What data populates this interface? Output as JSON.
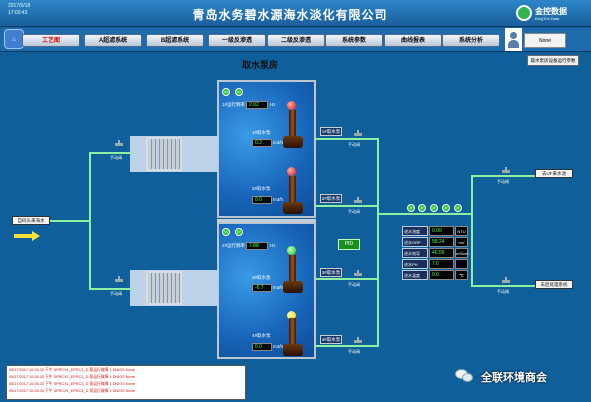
{
  "header": {
    "date": "2017/5/18",
    "time": "17:00:43",
    "title": "青岛水务碧水源海水淡化有限公司",
    "logo_main": "金控数据",
    "logo_sub": "KingTrol Data"
  },
  "nav": {
    "home_icon": "home-icon",
    "tabs": [
      "工艺图",
      "A超滤系统",
      "B超滤系统",
      "一级反渗透",
      "二级反渗透",
      "系统参数",
      "曲线报表",
      "系统分析"
    ],
    "active_tab": "工艺图",
    "user_icon": "user-icon",
    "username": "None"
  },
  "page": {
    "title": "取水泵房",
    "right_button": "取水泵房设备运行参数"
  },
  "pipes": {
    "seawater_in": "自码头来海水",
    "manual_valve": "手动阀",
    "outlets": [
      "去UF来水池",
      "去后处理系统"
    ]
  },
  "pumps": [
    {
      "status": "1#运行频率",
      "freq": "2.02",
      "freq_unit": "Hz",
      "name": "1#取水泵",
      "value": "0.2",
      "unit": "m3/h",
      "tag": "1#取水泵",
      "lamp": "red"
    },
    {
      "status": "",
      "freq": "",
      "freq_unit": "",
      "name": "2#取水泵",
      "value": "0.0",
      "unit": "m3/h",
      "tag": "2#取水泵",
      "lamp": "red"
    },
    {
      "status": "2#运行频率",
      "freq": "7.88",
      "freq_unit": "Hz",
      "name": "3#取水泵",
      "value": "-6.7",
      "unit": "m3/h",
      "tag": "3#取水泵",
      "lamp": "green"
    },
    {
      "status": "",
      "freq": "",
      "freq_unit": "",
      "name": "4#取水泵",
      "value": "0.0",
      "unit": "m3/h",
      "tag": "4#取水泵",
      "lamp": "yellow"
    }
  ],
  "indicators": {
    "d1": "SS",
    "d2": "DT",
    "d3": "SS",
    "d4": "DT",
    "grid": [
      "AT",
      "AT",
      "AT",
      "AT",
      "AT"
    ]
  },
  "pid_button": "PID",
  "quality": {
    "rows": [
      {
        "name": "进水浊度",
        "value": "0.00",
        "unit": "NTU"
      },
      {
        "name": "进水ORP",
        "value": "58.24",
        "unit": "mV"
      },
      {
        "name": "进水电导",
        "value": "46.56",
        "unit": "mS/cm"
      },
      {
        "name": "进水PH",
        "value": "7.6",
        "unit": ""
      },
      {
        "name": "进水温度",
        "value": "0.0",
        "unit": "℃"
      }
    ]
  },
  "alarms": [
    {
      "time": "05/17/2017 10:26:33",
      "ampm": "下午",
      "tag": "SPRCXL_EPRC1_D",
      "desc": "泵运行故障",
      "level": "1",
      "type": "DNIOS",
      "user": "None"
    },
    {
      "time": "05/17/2017 10:26:33",
      "ampm": "下午",
      "tag": "SPRCXL_EPRC2_D",
      "desc": "泵运行故障",
      "level": "1",
      "type": "DNIOS",
      "user": "None"
    },
    {
      "time": "05/17/2017 10:26:33",
      "ampm": "下午",
      "tag": "SPRCXL_EPRC3_D",
      "desc": "泵运行故障",
      "level": "1",
      "type": "DNIOS",
      "user": "None"
    },
    {
      "time": "05/17/2017 10:26:33",
      "ampm": "下午",
      "tag": "SPRCXL_EPRC4_D",
      "desc": "泵运行故障",
      "level": "1",
      "type": "DNIOS",
      "user": "None"
    }
  ],
  "watermark": "全联环境商会",
  "colors": {
    "background": "#0e5f9a",
    "pipe": "#8ff0a0",
    "active_tab_text": "#d01010"
  }
}
